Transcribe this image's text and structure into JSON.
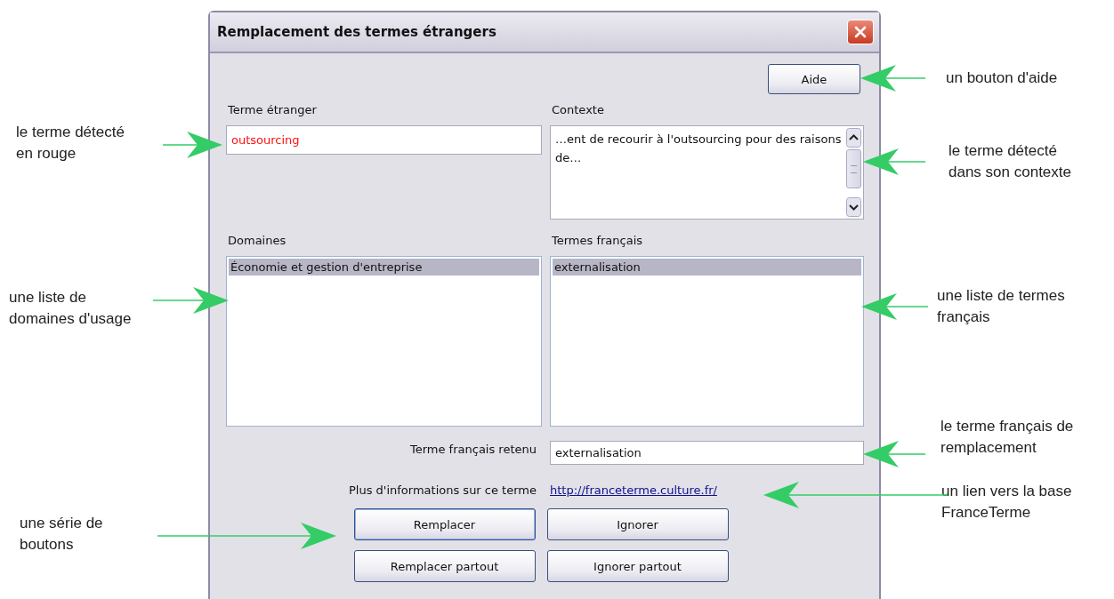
{
  "window": {
    "title": "Remplacement des termes étrangers"
  },
  "help_button": {
    "label": "Aide"
  },
  "foreign_term": {
    "label": "Terme étranger",
    "value": "outsourcing"
  },
  "context": {
    "label": "Contexte",
    "text": "…ent de recourir à l'outsourcing pour des raisons de…"
  },
  "domains": {
    "label": "Domaines",
    "items": [
      {
        "text": "Économie et gestion d'entreprise",
        "selected": true
      }
    ]
  },
  "french_terms": {
    "label": "Termes français",
    "items": [
      {
        "text": "externalisation",
        "selected": true
      }
    ]
  },
  "retained_term": {
    "label": "Terme français retenu",
    "value": "externalisation"
  },
  "more_info": {
    "text": "Plus d'informations sur ce terme",
    "link": "http://franceterme.culture.fr/"
  },
  "buttons": [
    {
      "label": "Remplacer",
      "default": true
    },
    {
      "label": "Ignorer",
      "default": false
    },
    {
      "label": "Remplacer partout",
      "default": false
    },
    {
      "label": "Ignorer partout",
      "default": false
    }
  ],
  "annotations": [
    {
      "text": "un bouton d'aide"
    },
    {
      "text": "le terme détecté\nen rouge"
    },
    {
      "text": "le terme détecté\ndans son contexte"
    },
    {
      "text": "une liste de\ndomaines d'usage"
    },
    {
      "text": "une liste de termes\nfrançais"
    },
    {
      "text": "le terme français de\nremplacement"
    },
    {
      "text": "un lien vers la base\nFranceTerme"
    },
    {
      "text": "une série de\nboutons"
    }
  ]
}
